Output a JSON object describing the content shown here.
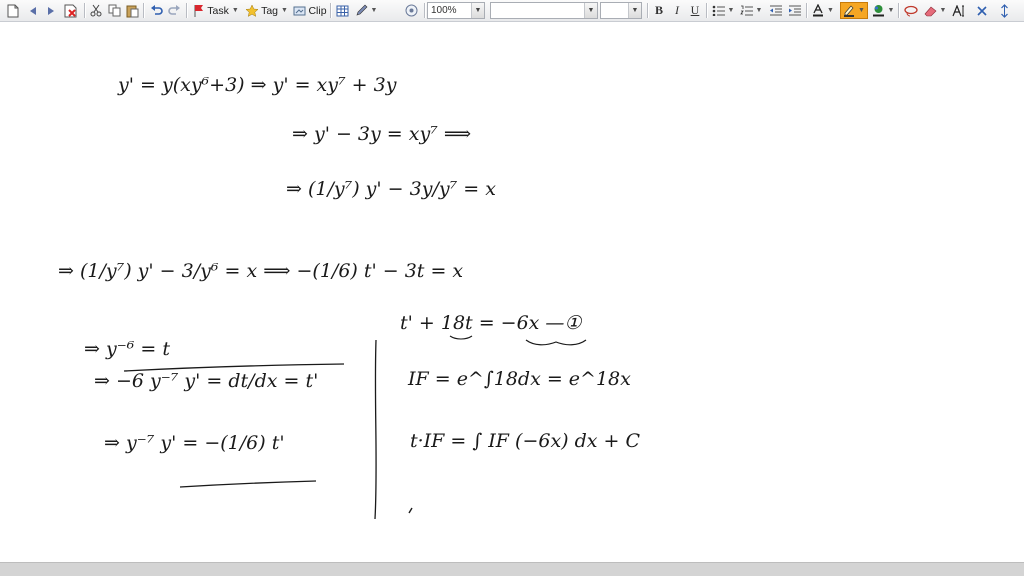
{
  "toolbar": {
    "task_label": "Task",
    "tag_label": "Tag",
    "clip_label": "Clip",
    "zoom_value": "100%",
    "font_value": "",
    "size_value": "",
    "bold_label": "B",
    "italic_label": "I",
    "underline_label": "U",
    "icons": [
      "new-page-icon",
      "back-icon",
      "forward-icon",
      "delete-page-icon",
      "cut-icon",
      "copy-icon",
      "paste-icon",
      "undo-icon",
      "redo-icon",
      "flag-icon",
      "star-icon",
      "clip-icon",
      "table-icon",
      "pen-tool-icon",
      "snapshot-icon",
      "bullets-icon",
      "numbering-icon",
      "outdent-icon",
      "indent-icon",
      "font-color-icon",
      "highlighter-icon",
      "fill-color-icon",
      "lasso-icon",
      "eraser-icon",
      "text-mode-icon",
      "close-icon",
      "line-spacing-icon"
    ]
  },
  "notes": {
    "line1": "y' = y(xy⁶+3)  ⇒  y' = xy⁷ + 3y",
    "line2": "⇒ y' − 3y = xy⁷ ⟹",
    "line3": "⇒ (1/y⁷) y' − 3y/y⁷ = x",
    "line4": "⇒ (1/y⁷) y' − 3/y⁶ = x  ⟹  −(1/6) t' − 3t = x",
    "sub1": "⇒ y⁻⁶ = t",
    "sub2": "⇒ −6 y⁻⁷ y' = dt/dx = t'",
    "sub3": "⇒ y⁻⁷ y' = −(1/6) t'",
    "step1": "t' + 18t = −6x  —①",
    "step2": "IF = e^∫18dx = e^18x",
    "step3": "t·IF = ∫ IF (−6x) dx + C"
  },
  "colors": {
    "ink": "#1a1a1a",
    "highlight_active": "#f5a623",
    "toolbar_bg": "#e9eaec",
    "scrollbar": "#d4d4d4"
  }
}
